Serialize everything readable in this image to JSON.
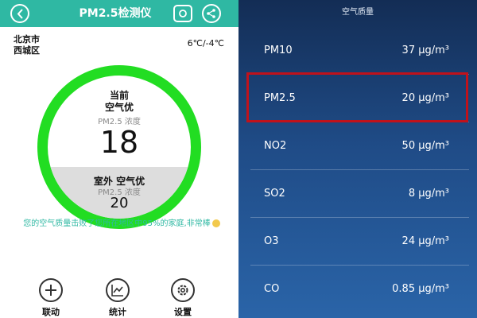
{
  "left": {
    "title": "PM2.5检测仪",
    "location_line1": "北京市",
    "location_line2": "西城区",
    "temperature": "6℃/-4℃",
    "indoor": {
      "label_line1": "当前",
      "label_line2": "空气优",
      "sub": "PM2.5 浓度",
      "value": "18"
    },
    "outdoor": {
      "label": "室外  空气优",
      "sub": "PM2.5 浓度",
      "value": "20"
    },
    "message": "您的空气质量击败了您所在地区中95%的家庭,非常棒",
    "nav": [
      {
        "label": "联动",
        "icon": "plus-circle-icon"
      },
      {
        "label": "统计",
        "icon": "chart-icon"
      },
      {
        "label": "设置",
        "icon": "gear-icon"
      }
    ],
    "colors": {
      "accent": "#2fb8a3",
      "ring": "#22dd22"
    }
  },
  "right": {
    "title": "空气质量",
    "rows": [
      {
        "name": "PM10",
        "value": "37 μg/m³"
      },
      {
        "name": "PM2.5",
        "value": "20 μg/m³"
      },
      {
        "name": "NO2",
        "value": "50 μg/m³"
      },
      {
        "name": "SO2",
        "value": "8 μg/m³"
      },
      {
        "name": "O3",
        "value": "24 μg/m³"
      },
      {
        "name": "CO",
        "value": "0.85 μg/m³"
      }
    ],
    "highlighted_row": "PM2.5",
    "colors": {
      "highlight": "#c0121b"
    }
  }
}
